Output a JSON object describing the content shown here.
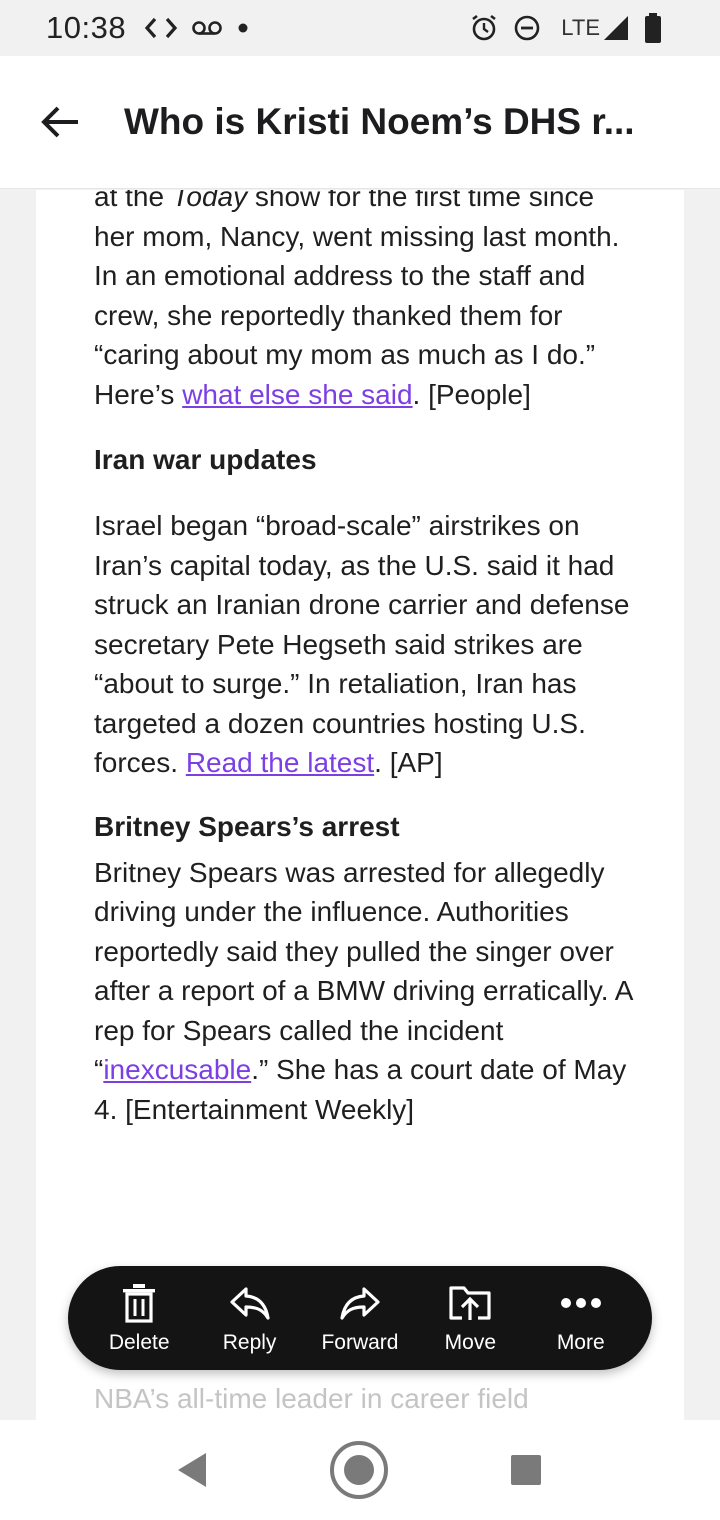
{
  "status_bar": {
    "time": "10:38",
    "network": "LTE",
    "icons": [
      "code-icon",
      "voicemail-icon",
      "dot-icon",
      "alarm-icon",
      "do-not-disturb-icon",
      "signal-icon",
      "battery-icon"
    ]
  },
  "header": {
    "title": "Who is Kristi Noem’s DHS r..."
  },
  "article": {
    "p1_before_em": "at the ",
    "p1_em": "Today",
    "p1_after_em": " show for the first time since her mom, Nancy, went missing last month. In an emotional address to the staff and crew, she reportedly thanked them for “caring about my mom as much as I do.” Here’s ",
    "p1_link": "what else she said",
    "p1_end": ". [People]",
    "h2": "Iran war updates",
    "p2_text": "Israel began “broad-scale” airstrikes on Iran’s capital today, as the U.S. said it had struck an Iranian drone carrier and defense secretary Pete Hegseth said strikes are “about to surge.” In retaliation, Iran has targeted a dozen countries hosting U.S. forces. ",
    "p2_link": "Read the latest",
    "p2_end": ". [AP]",
    "h3": "Britney Spears’s arrest",
    "p3_text": "Britney Spears was arrested for allegedly driving under the influence. Authorities reportedly said they pulled the singer over after a report of a BMW driving erratically. A rep for Spears called the incident “",
    "p3_link": "inexcusable",
    "p3_end": ".” She has a court date of May 4. [Entertainment Weekly]",
    "cutoff_line": "NBA’s all-time leader in career field"
  },
  "actions": [
    {
      "label": "Delete",
      "icon": "trash-icon"
    },
    {
      "label": "Reply",
      "icon": "reply-icon"
    },
    {
      "label": "Forward",
      "icon": "forward-icon"
    },
    {
      "label": "Move",
      "icon": "move-icon"
    },
    {
      "label": "More",
      "icon": "more-dots-icon"
    }
  ],
  "colors": {
    "link": "#7b3fe4",
    "action_bar_bg": "#141414",
    "page_bg": "#f1f1f1"
  }
}
